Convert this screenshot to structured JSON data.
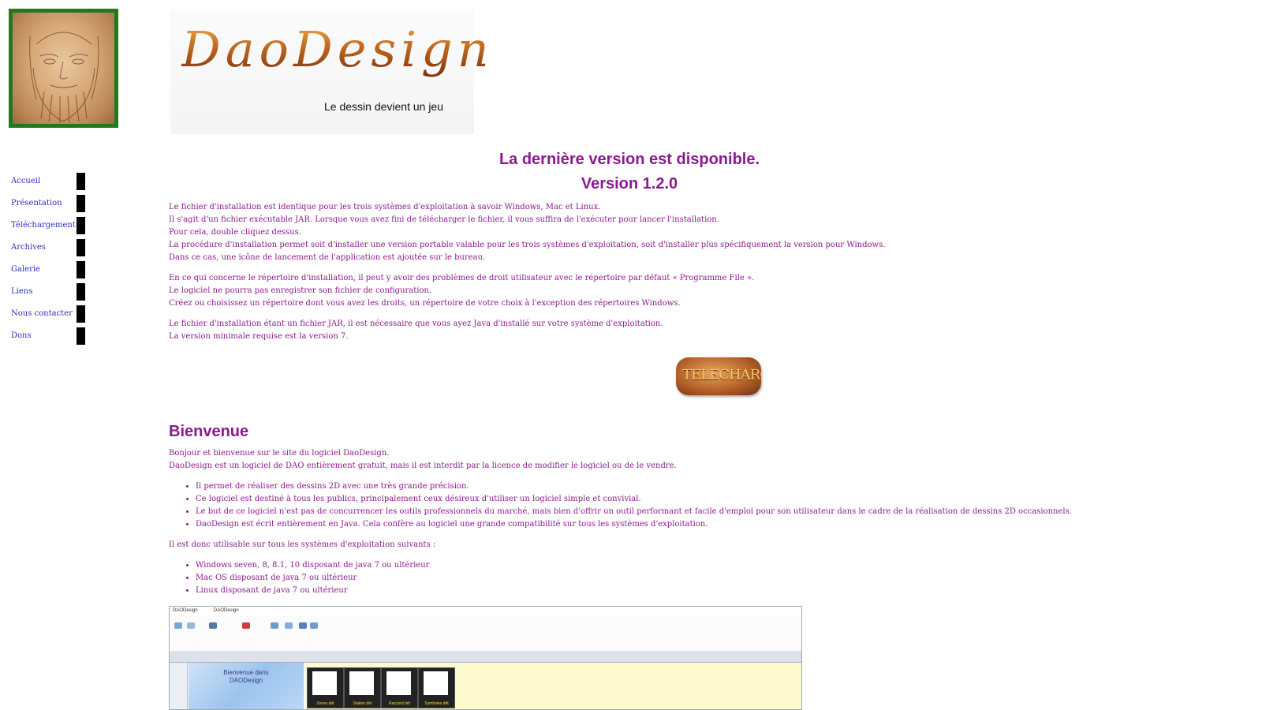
{
  "logo": {
    "title": "DaoDesign",
    "tagline": "Le dessin devient un jeu"
  },
  "sidebar": {
    "items": [
      {
        "label": "Accueil"
      },
      {
        "label": "Présentation"
      },
      {
        "label": "Téléchargement"
      },
      {
        "label": "Archives"
      },
      {
        "label": "Galerie"
      },
      {
        "label": "Liens"
      },
      {
        "label": "Nous contacter"
      },
      {
        "label": "Dons"
      }
    ]
  },
  "announcement": {
    "line1": "La dernière version est disponible.",
    "line2": "Version 1.2.0"
  },
  "install": {
    "p1": [
      "Le fichier d'installation est identique pour les trois systèmes d'exploitation à savoir Windows, Mac et Linux.",
      "Il s'agit d'un fichier exécutable JAR. Lorsque vous avez fini de télécharger le fichier, il vous suffira de l'exécuter pour lancer l'installation.",
      "Pour cela, double cliquez dessus.",
      "La procédure d'installation permet soit d'installer une version portable valable pour les trois systèmes d'exploitation, soit d'installer plus spécifiquement la version pour Windows.",
      "Dans ce cas, une icône de lancement de l'application est ajoutée sur le bureau."
    ],
    "p2": [
      "En ce qui concerne le répertoire d'installation, il peut y avoir des problèmes de droit utilisateur avec le répertoire par défaut « Programme File ».",
      "Le logiciel ne pourra pas enregistrer son fichier de configuration.",
      "Créez ou choisissez un répertoire dont vous avez les droits, un répertoire de votre choix à l'exception des répertoires Windows."
    ],
    "p3": [
      "Le fichier d'installation étant un fichier JAR, il est nécessaire que vous ayez Java d'installé sur votre système d'exploitation.",
      "La version minimale requise est la version 7."
    ],
    "download_label": "TELECHARGER"
  },
  "welcome": {
    "title": "Bienvenue",
    "intro": [
      "Bonjour et bienvenue sur le site du logiciel DaoDesign.",
      "DaoDesign est un logiciel de DAO entièrement gratuit, mais il est interdit par la licence de modifier le logiciel ou de le vendre."
    ],
    "bullets": [
      "Il permet de réaliser des dessins 2D avec une très grande précision.",
      "Ce logiciel est destiné à tous les publics, principalement ceux désireux d'utiliser un logiciel simple et convivial.",
      "Le but de ce logiciel n'est pas de concurrencer les outils professionnels du marché, mais bien d'offrir un outil performant et facile d'emploi pour son utilisateur dans le cadre de la réalisation de dessins 2D occasionnels.",
      "DaoDesign est écrit entièrement en Java. Cela confère au logiciel une grande compatibilité sur tous les systèmes d'exploitation."
    ],
    "os_intro": "Il est donc utilisable sur tous les systèmes d'exploitation suivants :",
    "os_list": [
      "Windows seven, 8, 8.1, 10 disposant de java 7 ou ultérieur",
      "Mac OS disposant de java 7 ou ultérieur",
      "Linux disposant de java 7 ou ultérieur"
    ]
  },
  "screenshot": {
    "window_title": "DAODesign",
    "app_name": "DAODesign",
    "welcome_text": [
      "Bienvenue dans",
      "DAODesign"
    ],
    "thumbnails": [
      "Zones dét",
      "Station dét",
      "Raccord dét",
      "Symboles dét"
    ]
  },
  "colors": {
    "text": "#8a1a8a",
    "nav": "#2f2fbf",
    "heading": "#8b1a92",
    "portrait_frame": "#1f7a1f"
  }
}
